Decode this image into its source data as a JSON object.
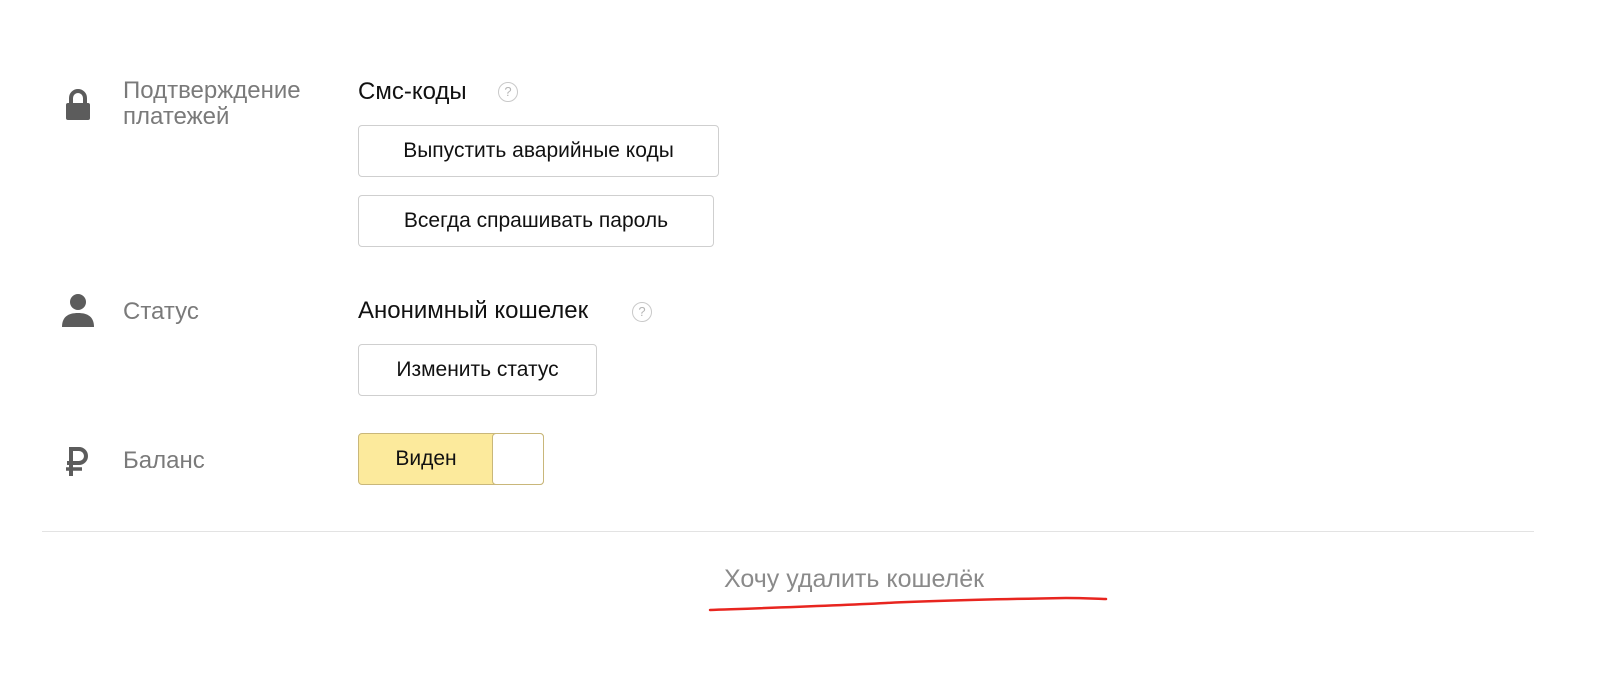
{
  "payment_confirmation": {
    "label_line1": "Подтверждение",
    "label_line2": "платежей",
    "value": "Смс-коды",
    "help": "?",
    "emergency_codes_button": "Выпустить аварийные коды",
    "always_ask_password_button": "Всегда спрашивать пароль"
  },
  "status": {
    "label": "Статус",
    "value": "Анонимный кошелек",
    "help": "?",
    "change_status_button": "Изменить статус"
  },
  "balance": {
    "label": "Баланс",
    "toggle_label": "Виден",
    "visible": true
  },
  "delete_wallet_link": "Хочу удалить кошелёк",
  "colors": {
    "toggle_on": "#fcea9c",
    "annotation_underline": "#e8251f",
    "label_text": "#7a7a7a"
  },
  "icons": {
    "payment_confirmation": "lock-icon",
    "status": "user-icon",
    "balance": "ruble-icon"
  }
}
